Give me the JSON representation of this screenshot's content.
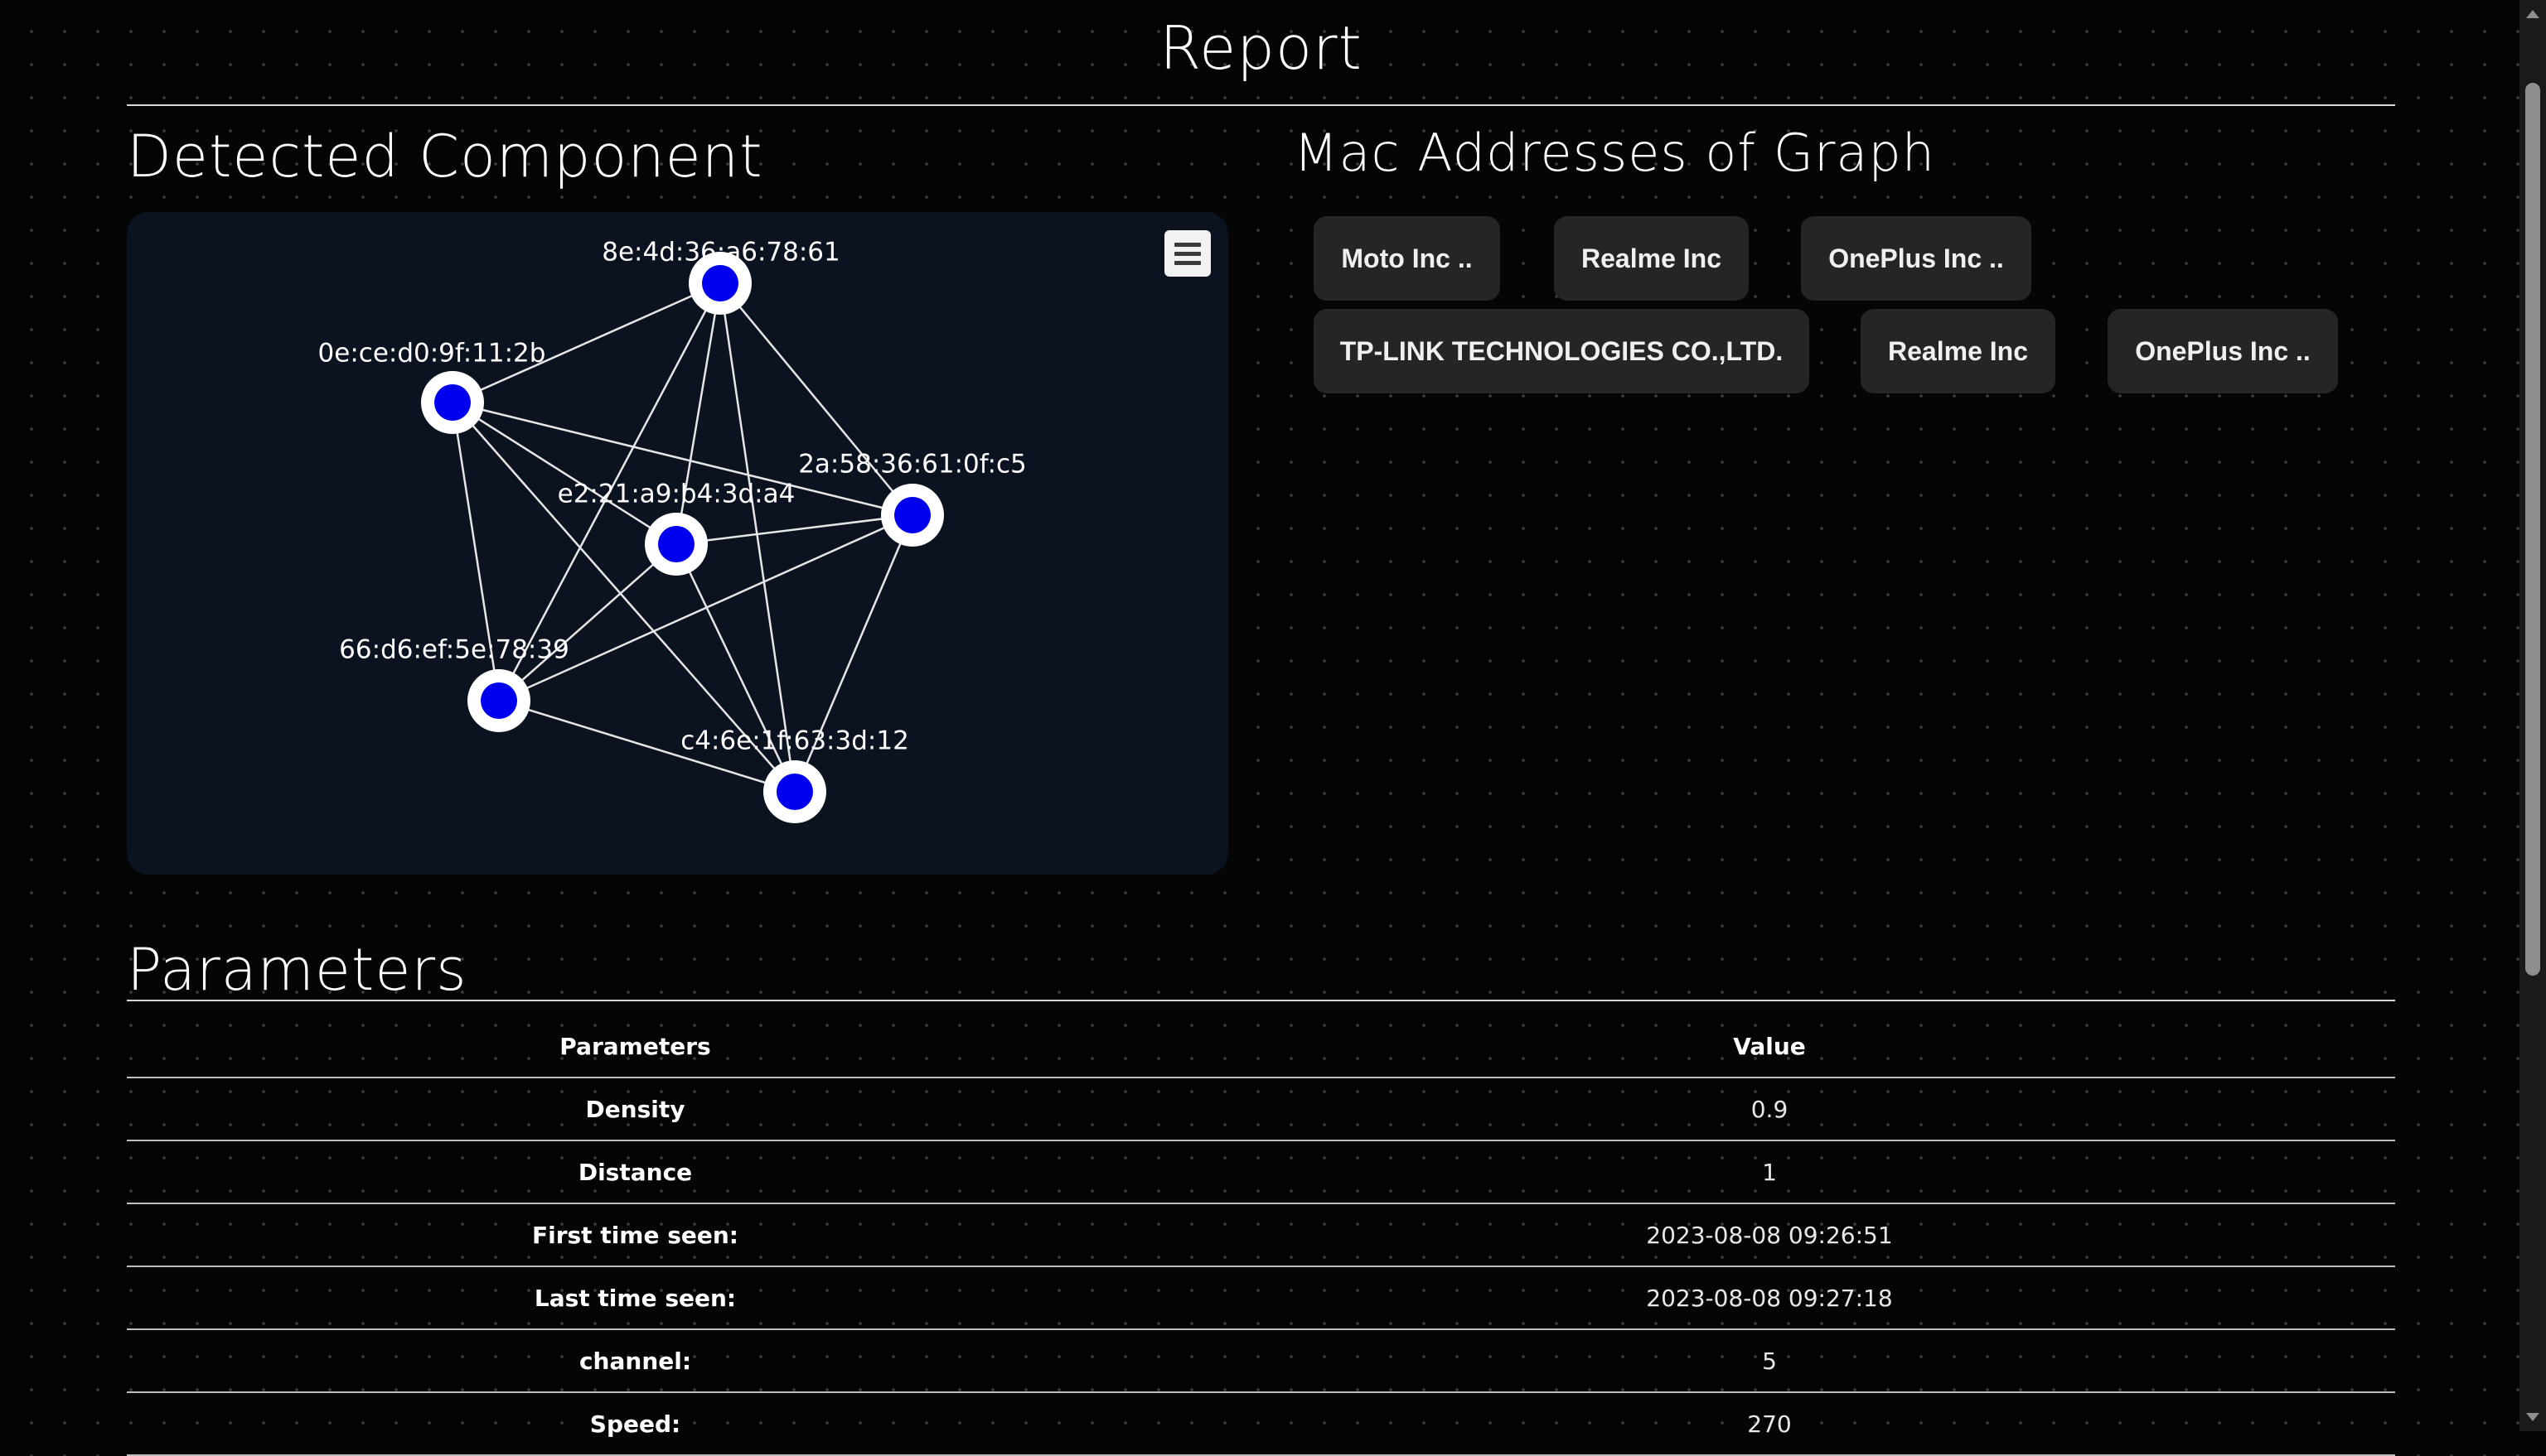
{
  "header": {
    "title": "Report"
  },
  "graph": {
    "title": "Detected Component",
    "menu_icon": "hamburger-menu-icon",
    "node_color": "#0000ee",
    "nodes": [
      {
        "id": "n1",
        "label": "8e:4d:36:a6:78:61"
      },
      {
        "id": "n2",
        "label": "0e:ce:d0:9f:11:2b"
      },
      {
        "id": "n3",
        "label": "2a:58:36:61:0f:c5"
      },
      {
        "id": "n4",
        "label": "e2:21:a9:b4:3d:a4"
      },
      {
        "id": "n5",
        "label": "66:d6:ef:5e:78:39"
      },
      {
        "id": "n6",
        "label": "c4:6e:1f:63:3d:12"
      }
    ],
    "edges": [
      [
        "n1",
        "n2"
      ],
      [
        "n1",
        "n3"
      ],
      [
        "n1",
        "n4"
      ],
      [
        "n1",
        "n5"
      ],
      [
        "n1",
        "n6"
      ],
      [
        "n2",
        "n3"
      ],
      [
        "n2",
        "n4"
      ],
      [
        "n2",
        "n5"
      ],
      [
        "n2",
        "n6"
      ],
      [
        "n3",
        "n4"
      ],
      [
        "n3",
        "n5"
      ],
      [
        "n3",
        "n6"
      ],
      [
        "n4",
        "n5"
      ],
      [
        "n4",
        "n6"
      ],
      [
        "n5",
        "n6"
      ]
    ]
  },
  "mac_section": {
    "title": "Mac Addresses of Graph",
    "chips": [
      "Moto Inc ..",
      "Realme Inc",
      "OnePlus Inc ..",
      "TP-LINK TECHNOLOGIES CO.,LTD.",
      "Realme Inc",
      "OnePlus Inc .."
    ]
  },
  "parameters": {
    "title": "Parameters",
    "headers": [
      "Parameters",
      "Value"
    ],
    "rows": [
      {
        "name": "Density",
        "value": "0.9"
      },
      {
        "name": "Distance",
        "value": "1"
      },
      {
        "name": "First time seen:",
        "value": "2023-08-08 09:26:51"
      },
      {
        "name": "Last time seen:",
        "value": "2023-08-08 09:27:18"
      },
      {
        "name": "channel:",
        "value": "5"
      },
      {
        "name": "Speed:",
        "value": "270"
      }
    ]
  }
}
